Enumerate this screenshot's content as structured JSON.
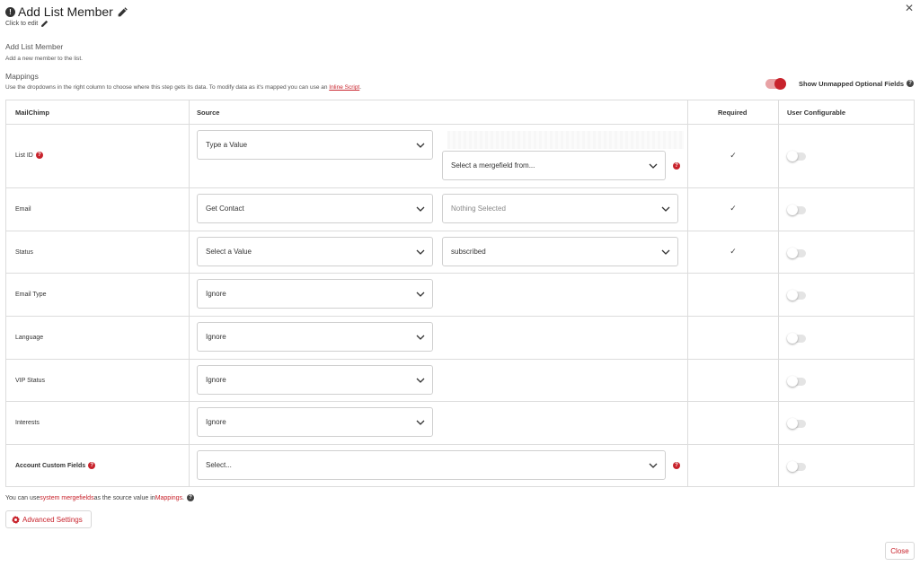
{
  "header": {
    "title": "Add List Member",
    "click_to_edit": "Click to edit",
    "alert_glyph": "!",
    "close_glyph": "✕"
  },
  "section": {
    "title": "Add List Member",
    "subtitle": "Add a new member to the list."
  },
  "mappings": {
    "title": "Mappings",
    "desc_before": "Use the dropdowns in the right column to choose where this step gets its data. To modify data as it's mapped you can use an ",
    "desc_link": "Inline Script",
    "desc_after": ".",
    "unmapped_label": "Show Unmapped Optional Fields",
    "unmapped_on": true
  },
  "columns": {
    "mailchimp": "MailChimp",
    "source": "Source",
    "required": "Required",
    "user_configurable": "User Configurable"
  },
  "rows": [
    {
      "label": "List ID",
      "source": "Type a Value",
      "secondary": "Select a mergefield from...",
      "required": "✓",
      "configurable": false
    },
    {
      "label": "Email",
      "source": "Get Contact",
      "secondary": "Nothing Selected",
      "required": "✓",
      "configurable": false
    },
    {
      "label": "Status",
      "source": "Select a Value",
      "secondary": "subscribed",
      "required": "✓",
      "configurable": false
    },
    {
      "label": "Email Type",
      "source": "Ignore",
      "configurable": false
    },
    {
      "label": "Language",
      "source": "Ignore",
      "configurable": false
    },
    {
      "label": "VIP Status",
      "source": "Ignore",
      "configurable": false
    },
    {
      "label": "Interests",
      "source": "Ignore",
      "configurable": false
    },
    {
      "label": "Account Custom Fields",
      "source": "Select...",
      "configurable": false
    }
  ],
  "footer": {
    "note_before": "You can use ",
    "note_link": "system mergefields",
    "note_middle": " as the source value in ",
    "note_link2": "Mappings",
    "note_after": ".",
    "advanced_settings": "Advanced Settings",
    "close": "Close"
  },
  "colors": {
    "accent": "#c8232c",
    "border": "#dcdcdc"
  },
  "icons": {
    "help": "?",
    "pencil": "pencil-icon",
    "gear": "gear-icon",
    "chevron": "chevron-down-icon"
  }
}
